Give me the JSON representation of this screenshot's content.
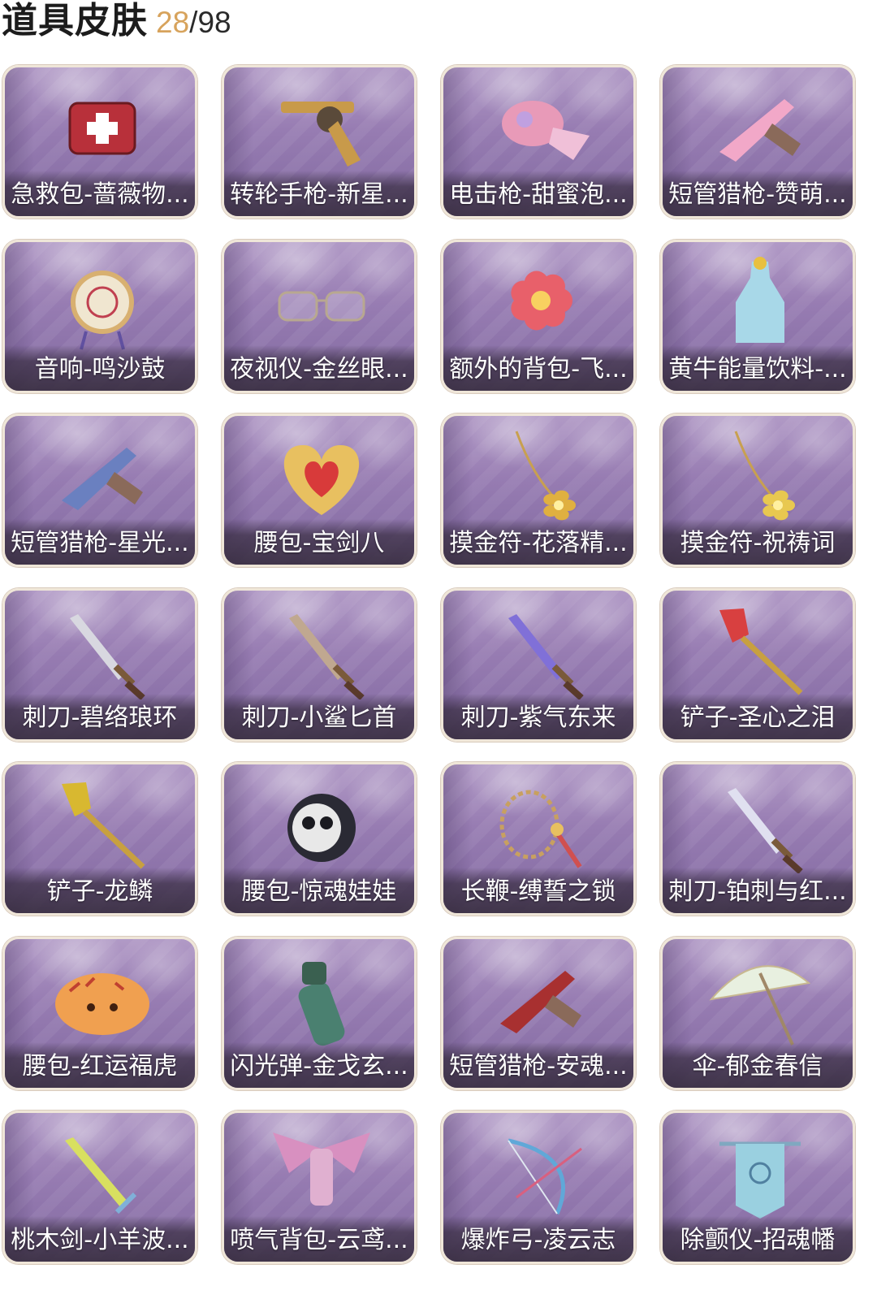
{
  "header": {
    "title": "道具皮肤",
    "owned": "28",
    "separator": "/",
    "total": "98"
  },
  "items": [
    {
      "label": "急救包-蔷薇物...",
      "icon": "first-aid-kit-icon",
      "color": "#b8303a"
    },
    {
      "label": "转轮手枪-新星...",
      "icon": "revolver-icon",
      "color": "#c89a4a"
    },
    {
      "label": "电击枪-甜蜜泡...",
      "icon": "stun-gun-icon",
      "color": "#e89ab8"
    },
    {
      "label": "短管猎枪-赞萌...",
      "icon": "shotgun-icon",
      "color": "#f2a8c8"
    },
    {
      "label": "音响-鸣沙鼓",
      "icon": "drum-icon",
      "color": "#d8b070"
    },
    {
      "label": "夜视仪-金丝眼...",
      "icon": "glasses-icon",
      "color": "#b8a890"
    },
    {
      "label": "额外的背包-飞...",
      "icon": "flower-backpack-icon",
      "color": "#e8606a"
    },
    {
      "label": "黄牛能量饮料-...",
      "icon": "energy-drink-icon",
      "color": "#a8d8e8"
    },
    {
      "label": "短管猎枪-星光...",
      "icon": "shotgun-icon",
      "color": "#6a80c0"
    },
    {
      "label": "腰包-宝剑八",
      "icon": "heart-pouch-icon",
      "color": "#e8c060"
    },
    {
      "label": "摸金符-花落精...",
      "icon": "amulet-icon",
      "color": "#e0b040"
    },
    {
      "label": "摸金符-祝祷词",
      "icon": "amulet-icon",
      "color": "#e8c850"
    },
    {
      "label": "刺刀-碧络琅环",
      "icon": "dagger-icon",
      "color": "#d8d8e0"
    },
    {
      "label": "刺刀-小鲨匕首",
      "icon": "dagger-icon",
      "color": "#c0a890"
    },
    {
      "label": "刺刀-紫气东来",
      "icon": "dagger-icon",
      "color": "#8070d8"
    },
    {
      "label": "铲子-圣心之泪",
      "icon": "shovel-icon",
      "color": "#d84040"
    },
    {
      "label": "铲子-龙鳞",
      "icon": "shovel-icon",
      "color": "#d8b830"
    },
    {
      "label": "腰包-惊魂娃娃",
      "icon": "skull-pouch-icon",
      "color": "#e8e8e8"
    },
    {
      "label": "长鞭-缚誓之锁",
      "icon": "whip-icon",
      "color": "#c8a060"
    },
    {
      "label": "刺刀-铂刺与红...",
      "icon": "dagger-icon",
      "color": "#e0e0f0"
    },
    {
      "label": "腰包-红运福虎",
      "icon": "tiger-pouch-icon",
      "color": "#f0a050"
    },
    {
      "label": "闪光弹-金戈玄...",
      "icon": "grenade-icon",
      "color": "#4a8070"
    },
    {
      "label": "短管猎枪-安魂...",
      "icon": "shotgun-icon",
      "color": "#a83030"
    },
    {
      "label": "伞-郁金春信",
      "icon": "umbrella-icon",
      "color": "#e8f0e0"
    },
    {
      "label": "桃木剑-小羊波...",
      "icon": "sword-icon",
      "color": "#d8e060"
    },
    {
      "label": "喷气背包-云鸢...",
      "icon": "jetpack-icon",
      "color": "#d890c0"
    },
    {
      "label": "爆炸弓-凌云志",
      "icon": "bow-icon",
      "color": "#60a8d8"
    },
    {
      "label": "除颤仪-招魂幡",
      "icon": "banner-icon",
      "color": "#9ad0e0"
    }
  ]
}
